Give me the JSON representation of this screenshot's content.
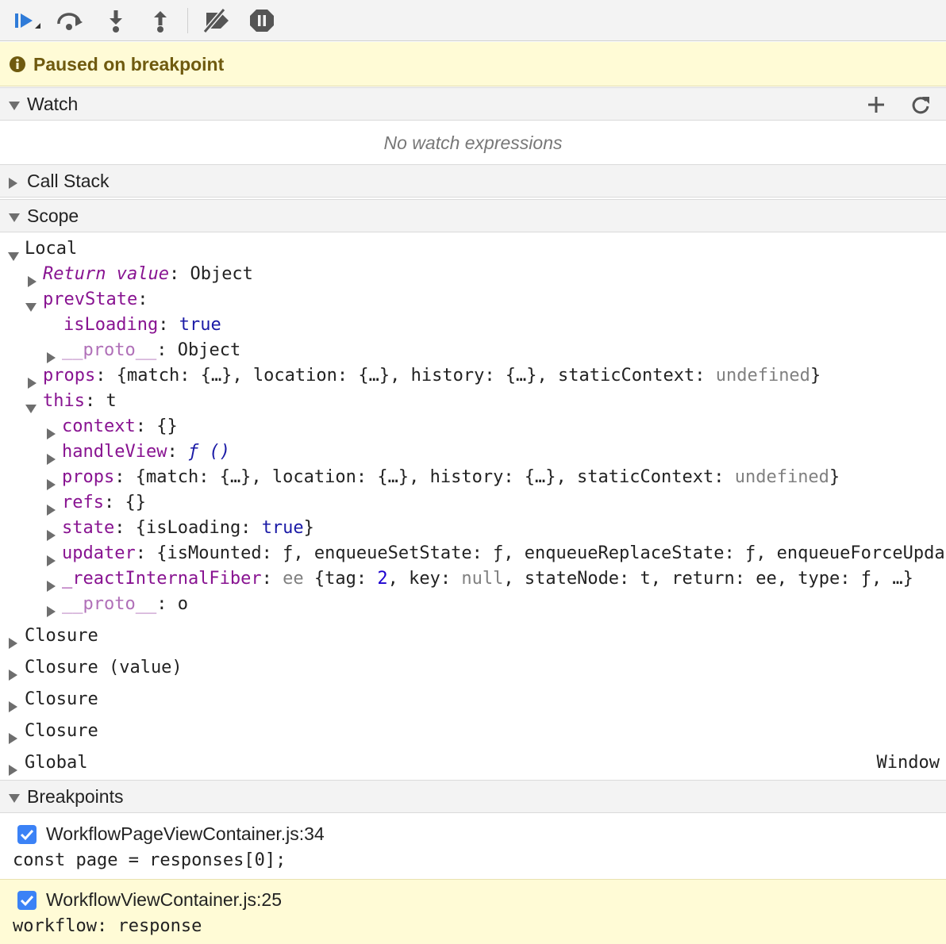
{
  "toolbar": {
    "buttons": [
      {
        "name": "resume-button",
        "icon": "resume-icon"
      },
      {
        "name": "step-over-button",
        "icon": "step-over-icon"
      },
      {
        "name": "step-into-button",
        "icon": "step-into-icon"
      },
      {
        "name": "step-out-button",
        "icon": "step-out-icon"
      },
      {
        "name": "deactivate-breakpoints-button",
        "icon": "deactivate-breakpoints-icon"
      },
      {
        "name": "pause-on-exceptions-button",
        "icon": "pause-icon"
      }
    ]
  },
  "paused_message": "Paused on breakpoint",
  "sections": {
    "watch": {
      "title": "Watch",
      "empty": "No watch expressions"
    },
    "call_stack": {
      "title": "Call Stack"
    },
    "scope": {
      "title": "Scope"
    },
    "breakpoints": {
      "title": "Breakpoints"
    }
  },
  "scope": {
    "local_label": "Local",
    "return_value_key": "Return value",
    "return_value_val": "Object",
    "prevState_key": "prevState",
    "isLoading_key": "isLoading",
    "isLoading_val": "true",
    "proto_key": "__proto__",
    "proto_val": "Object",
    "props_key": "props",
    "props_val_a": "{match: {…}, location: {…}, history: {…}, staticContext: ",
    "props_val_undef": "undefined",
    "props_val_end": "}",
    "this_key": "this",
    "this_val": "t",
    "this_children": {
      "context_key": "context",
      "context_val": "{}",
      "handleView_key": "handleView",
      "handleView_val": "ƒ ()",
      "props_key": "props",
      "refs_key": "refs",
      "refs_val": "{}",
      "state_key": "state",
      "state_val_a": "{isLoading: ",
      "state_val_b": "true",
      "state_val_c": "}",
      "updater_key": "updater",
      "updater_val": "{isMounted: ƒ, enqueueSetState: ƒ, enqueueReplaceState: ƒ, enqueueForceUpdat",
      "fiber_key": "_reactInternalFiber",
      "fiber_type": "ee",
      "fiber_val_a": "{tag: ",
      "fiber_val_num": "2",
      "fiber_val_b": ", key: ",
      "fiber_val_null": "null",
      "fiber_val_c": ", stateNode: t, return: ee, type: ƒ, …}",
      "proto_key": "__proto__",
      "proto_val": "o"
    },
    "closures": [
      "Closure",
      "Closure (value)",
      "Closure",
      "Closure"
    ],
    "global_label": "Global",
    "global_val": "Window"
  },
  "breakpoints": [
    {
      "file": "WorkflowPageViewContainer.js:34",
      "code": "const page = responses[0];",
      "checked": true,
      "active": false
    },
    {
      "file": "WorkflowViewContainer.js:25",
      "code": "workflow: response",
      "checked": true,
      "active": true
    }
  ]
}
